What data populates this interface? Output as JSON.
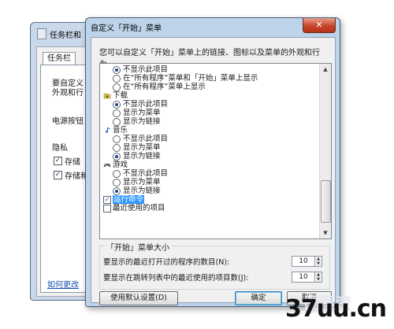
{
  "background_window": {
    "title": "任务栏和",
    "tab": "任务栏",
    "text_lines": [
      "要自定义",
      "外观和行"
    ],
    "power_label": "电源按钮",
    "privacy_label": "隐私",
    "privacy_items": [
      "存储",
      "存储和"
    ],
    "link": "如何更改"
  },
  "dialog": {
    "title": "自定义「开始」菜单",
    "close_glyph": "✕",
    "description": "您可以自定义「开始」菜单上的链接、图标以及菜单的外观和行为。",
    "list_items": [
      {
        "kind": "radio",
        "checked": true,
        "label": "不显示此项目"
      },
      {
        "kind": "radio",
        "checked": false,
        "label": "在“所有程序”菜单和「开始」菜单上显示"
      },
      {
        "kind": "radio",
        "checked": false,
        "label": "在“所有程序”菜单上显示"
      },
      {
        "kind": "category",
        "icon": "download-icon",
        "label": "下载"
      },
      {
        "kind": "radio",
        "checked": true,
        "label": "不显示此项目"
      },
      {
        "kind": "radio",
        "checked": false,
        "label": "显示为菜单"
      },
      {
        "kind": "radio",
        "checked": false,
        "label": "显示为链接"
      },
      {
        "kind": "category",
        "icon": "music-icon",
        "label": "音乐"
      },
      {
        "kind": "radio",
        "checked": false,
        "label": "不显示此项目"
      },
      {
        "kind": "radio",
        "checked": false,
        "label": "显示为菜单"
      },
      {
        "kind": "radio",
        "checked": true,
        "label": "显示为链接"
      },
      {
        "kind": "category",
        "icon": "games-icon",
        "label": "游戏"
      },
      {
        "kind": "radio",
        "checked": false,
        "label": "不显示此项目"
      },
      {
        "kind": "radio",
        "checked": false,
        "label": "显示为菜单"
      },
      {
        "kind": "radio",
        "checked": true,
        "label": "显示为链接"
      },
      {
        "kind": "checkbox",
        "checked": true,
        "selected": true,
        "label": "运行命令"
      },
      {
        "kind": "checkbox",
        "checked": false,
        "label": "最近使用的项目"
      }
    ],
    "size_group": {
      "legend": "「开始」菜单大小",
      "recent_programs_label": "要显示的最近打开过的程序的数目(N):",
      "recent_programs_value": "10",
      "jump_list_label": "要显示在跳转列表中的最近使用的项目数(J):",
      "jump_list_value": "10"
    },
    "buttons": {
      "defaults": "使用默认设置(D)",
      "ok": "确定",
      "cancel": "取消"
    }
  },
  "watermark": {
    "text": "37uu.cn",
    "faint_text": "国屋资"
  },
  "colors": {
    "selection": "#3399ff",
    "title_bar": "#bcd3ea",
    "close_button": "#c8452b"
  }
}
